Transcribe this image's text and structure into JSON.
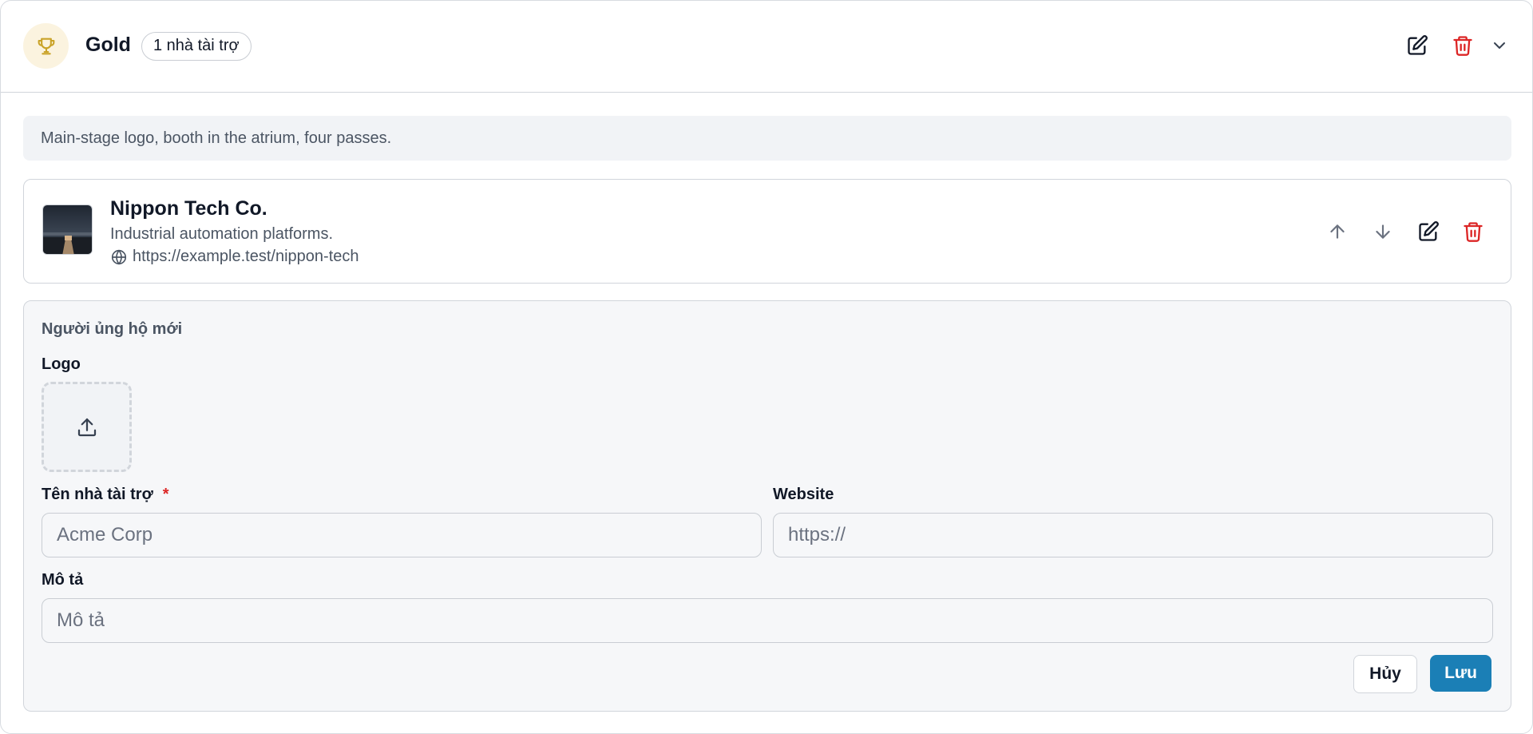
{
  "tier": {
    "name": "Gold",
    "count_badge": "1 nhà tài trợ",
    "icon": "trophy-icon",
    "icon_color": "#c9a227",
    "description": "Main-stage logo, booth in the atrium, four passes."
  },
  "sponsor": {
    "name": "Nippon Tech Co.",
    "description": "Industrial automation platforms.",
    "url": "https://example.test/nippon-tech"
  },
  "form": {
    "title": "Người ủng hộ mới",
    "logo_label": "Logo",
    "name_label": "Tên nhà tài trợ",
    "required_mark": "*",
    "name_placeholder": "Acme Corp",
    "name_value": "",
    "website_label": "Website",
    "website_placeholder": "https://",
    "website_value": "",
    "desc_label": "Mô tả",
    "desc_placeholder": "Mô tả",
    "desc_value": "",
    "cancel_label": "Hủy",
    "save_label": "Lưu"
  },
  "colors": {
    "danger": "#dc2626",
    "primary": "#1b7fb6",
    "trophy_bg": "#fbf3df"
  }
}
